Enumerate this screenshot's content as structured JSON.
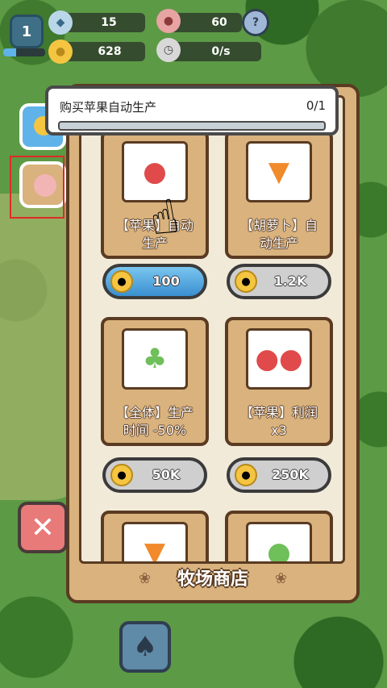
{
  "hud": {
    "level": "1",
    "level_progress": 0.3,
    "gems": "15",
    "icecream": "60",
    "coins": "628",
    "rate": "0/s",
    "help_glyph": "?"
  },
  "quest": {
    "label": "购买苹果自动生产",
    "count": "0/1",
    "progress": 0.0
  },
  "shop": {
    "title": "牧场商店",
    "items": [
      {
        "icon": "apple-conveyor-icon",
        "line1": "【苹果】自动",
        "line2": "生产",
        "price": "100",
        "active": true
      },
      {
        "icon": "carrot-conveyor-icon",
        "line1": "【胡萝卜】自",
        "line2": "动生产",
        "price": "1.2K",
        "active": false
      },
      {
        "icon": "bush-clock-icon",
        "line1": "【全体】生产",
        "line2": "时间 -50%",
        "price": "50K",
        "active": false
      },
      {
        "icon": "apple-crate-icon",
        "line1": "【苹果】利润",
        "line2": "x3",
        "price": "250K",
        "active": false
      }
    ]
  },
  "colors": {
    "panel": "#d9b27d",
    "border": "#5a3b22",
    "active_price": "#3a8fd0",
    "close": "#e97a7a"
  }
}
